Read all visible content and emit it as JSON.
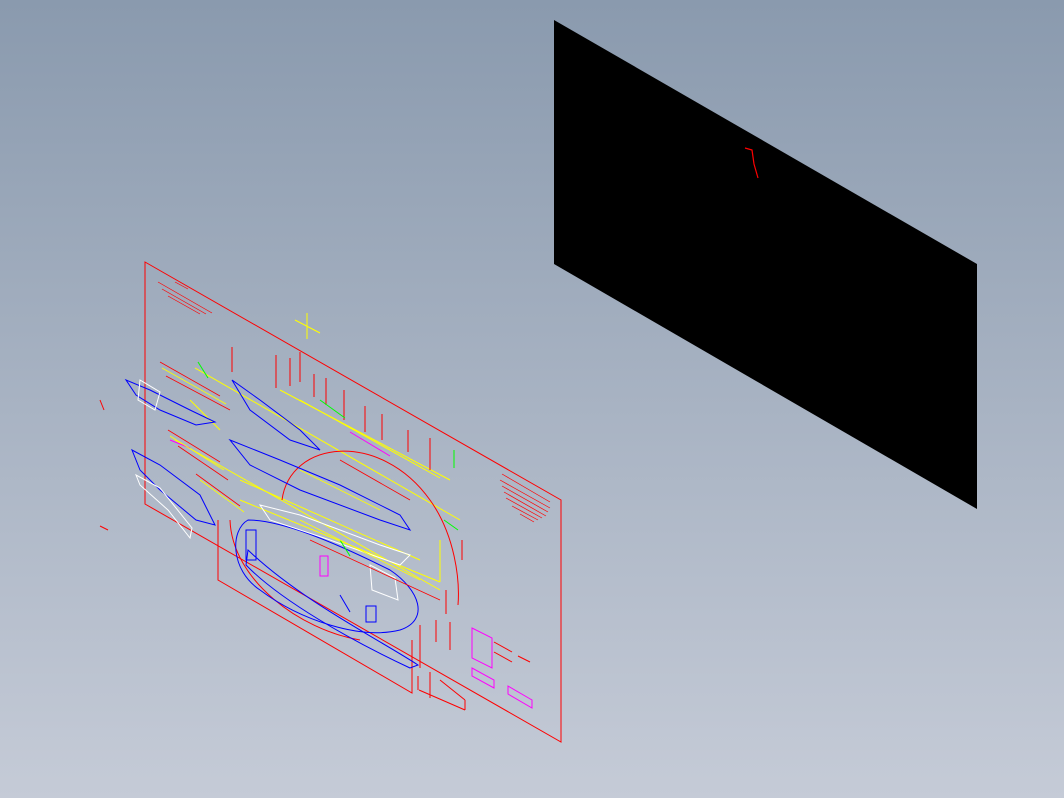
{
  "viewport": {
    "background_top": "#8a9aae",
    "background_bottom": "#c5cbd7"
  },
  "black_panel": {
    "fill": "#000000",
    "marker_color": "#ff0000"
  },
  "drawing_sheet": {
    "frame_color": "#ff0000",
    "colors": {
      "red": "#ff0000",
      "blue": "#0000ff",
      "yellow": "#ffff00",
      "green": "#00ff00",
      "magenta": "#ff00ff",
      "white": "#ffffff",
      "grey": "#808080"
    },
    "cursor_icon": "crosshair-icon"
  }
}
